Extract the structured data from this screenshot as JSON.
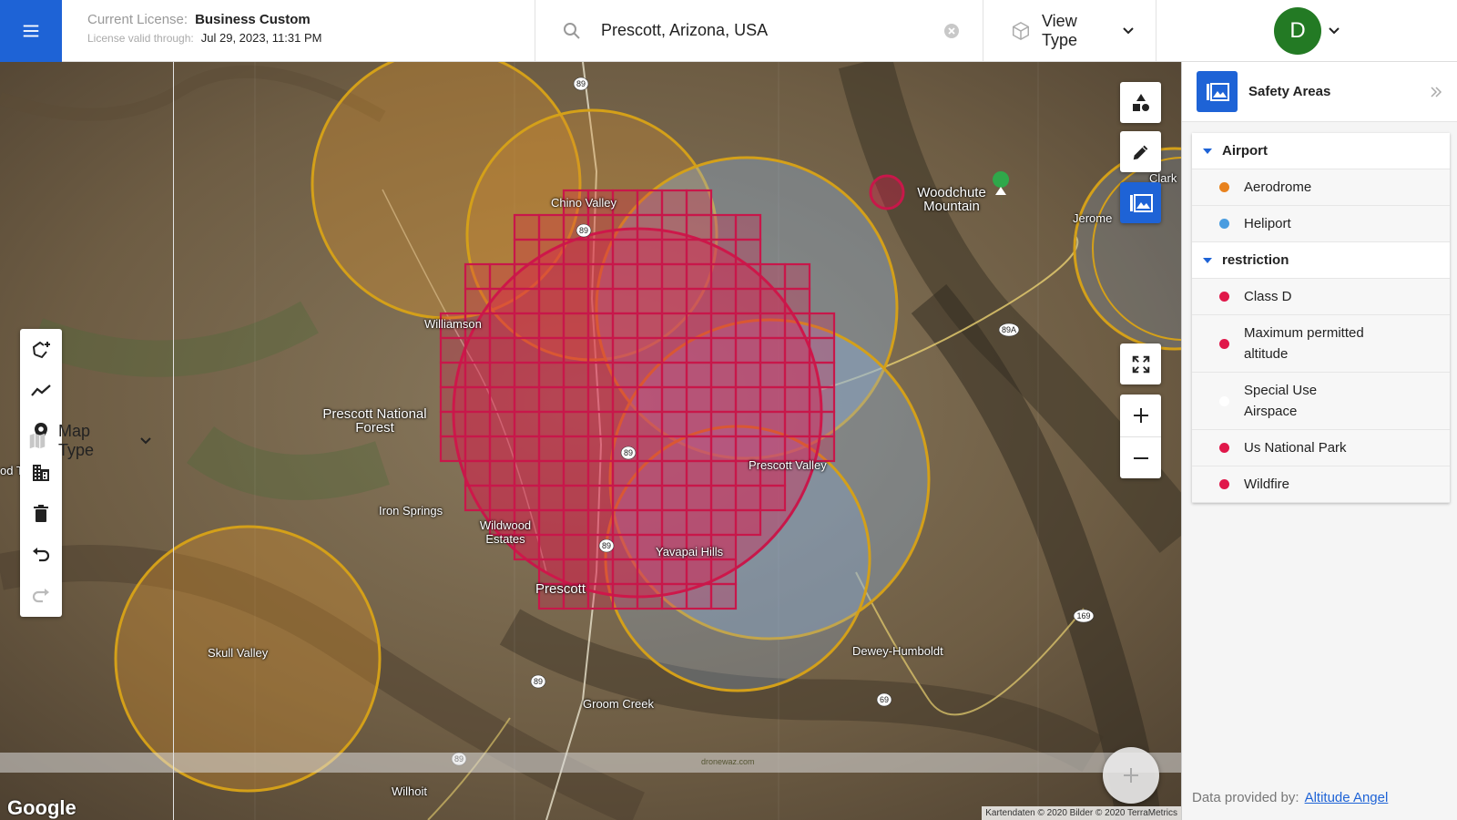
{
  "header": {
    "license_label": "Current License:",
    "license_value": "Business Custom",
    "valid_label": "License valid through:",
    "valid_value": "Jul 29, 2023, 11:31 PM",
    "search_value": "Prescott, Arizona, USA",
    "view_type_label": "View Type",
    "map_type_label": "Map Type",
    "avatar_initial": "D"
  },
  "map": {
    "labels": [
      {
        "text": "Chino Valley"
      },
      {
        "text": "Williamson"
      },
      {
        "text": "Prescott National Forest"
      },
      {
        "text": "Iron Springs"
      },
      {
        "text": "Wildwood Estates"
      },
      {
        "text": "Prescott"
      },
      {
        "text": "Prescott Valley"
      },
      {
        "text": "Yavapai Hills"
      },
      {
        "text": "Woodchute Mountain"
      },
      {
        "text": "Jerome"
      },
      {
        "text": "Skull Valley"
      },
      {
        "text": "Groom Creek"
      },
      {
        "text": "Dewey-Humboldt"
      },
      {
        "text": "Wilhoit"
      },
      {
        "text": "od Trap"
      },
      {
        "text": "Clark"
      }
    ],
    "route_shields": [
      "89",
      "89",
      "89",
      "89",
      "89",
      "89",
      "89A",
      "169",
      "69"
    ],
    "google_logo": "Google",
    "attribution": "Kartendaten © 2020 Bilder © 2020 TerraMetrics",
    "watermark": "dronewaz.com"
  },
  "panel": {
    "title": "Safety Areas",
    "groups": [
      {
        "label": "Airport",
        "items": [
          {
            "label": "Aerodrome",
            "color": "#e8821e"
          },
          {
            "label": "Heliport",
            "color": "#4a9de0"
          }
        ]
      },
      {
        "label": "restriction",
        "items": [
          {
            "label": "Class D",
            "color": "#e0184a"
          },
          {
            "label": "Maximum permitted altitude",
            "color": "#e0184a"
          },
          {
            "label": "Special Use Airspace",
            "color": "#ffffff"
          },
          {
            "label": "Us National Park",
            "color": "#e0184a"
          },
          {
            "label": "Wildfire",
            "color": "#e0184a"
          }
        ]
      }
    ],
    "data_provided_label": "Data provided by:",
    "data_provider_link": "Altitude Angel"
  },
  "colors": {
    "accent": "#1e63d6",
    "aerodrome_ring": "#d4a019",
    "restriction": "#d81e4e",
    "avatar": "#237a24"
  }
}
